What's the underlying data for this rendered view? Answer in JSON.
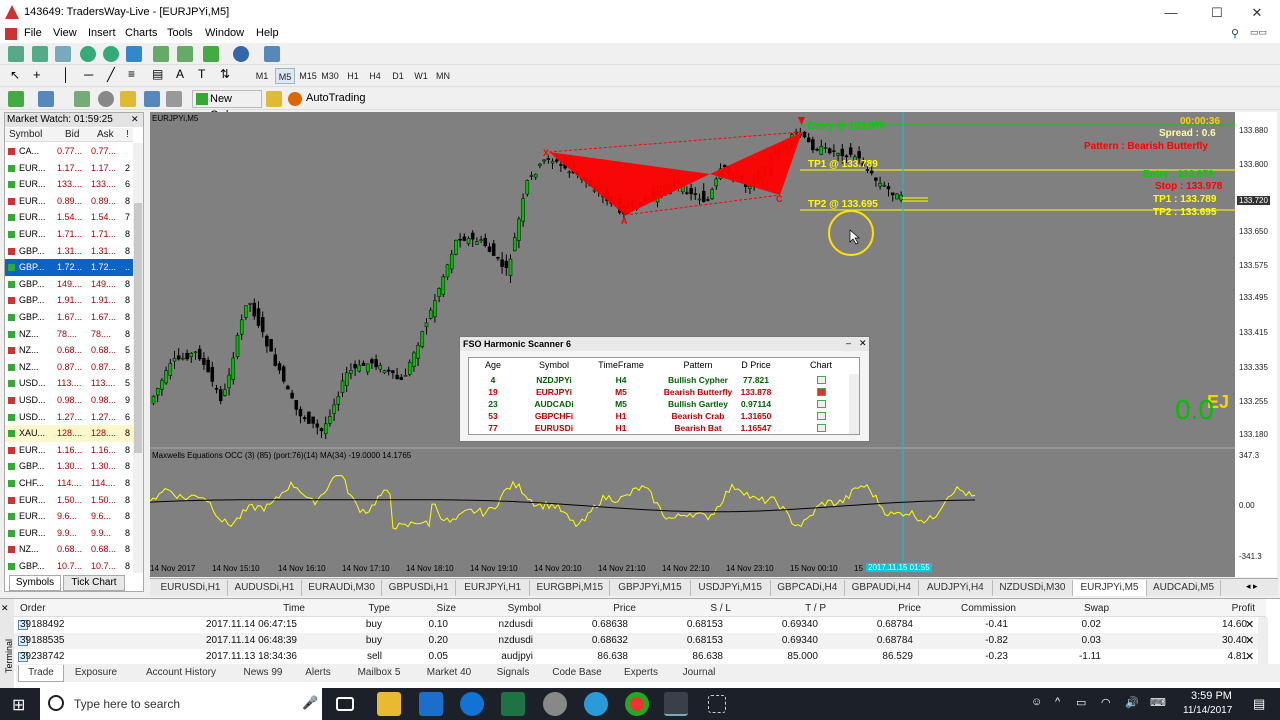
{
  "window": {
    "title": "143649: TradersWay-Live - [EURJPYi,M5]",
    "controls": {
      "minimize": "—",
      "maximize": "☐",
      "close": "✕"
    }
  },
  "menu": [
    "File",
    "View",
    "Insert",
    "Charts",
    "Tools",
    "Window",
    "Help"
  ],
  "timeframes": [
    "M1",
    "M5",
    "M15",
    "M30",
    "H1",
    "H4",
    "D1",
    "W1",
    "MN"
  ],
  "toolbar": {
    "new_order": "New Order",
    "autotrading": "AutoTrading"
  },
  "market_watch": {
    "title": "Market Watch: 01:59:25",
    "cols": [
      "Symbol",
      "Bid",
      "Ask",
      "!"
    ],
    "rows": [
      [
        "CA...",
        "0.77...",
        "0.77...",
        ""
      ],
      [
        "EUR...",
        "1.17...",
        "1.17...",
        "2"
      ],
      [
        "EUR...",
        "133....",
        "133....",
        "6"
      ],
      [
        "EUR...",
        "0.89...",
        "0.89...",
        "8"
      ],
      [
        "EUR...",
        "1.54...",
        "1.54...",
        "7"
      ],
      [
        "EUR...",
        "1.71...",
        "1.71...",
        "8"
      ],
      [
        "GBP...",
        "1.31...",
        "1.31...",
        "8"
      ],
      [
        "GBP...",
        "1.72...",
        "1.72...",
        ".."
      ],
      [
        "GBP...",
        "149....",
        "149....",
        "8"
      ],
      [
        "GBP...",
        "1.91...",
        "1.91...",
        "8"
      ],
      [
        "GBP...",
        "1.67...",
        "1.67...",
        "8"
      ],
      [
        "NZ...",
        "78....",
        "78....",
        "8"
      ],
      [
        "NZ...",
        "0.68...",
        "0.68...",
        "5"
      ],
      [
        "NZ...",
        "0.87...",
        "0.87...",
        "8"
      ],
      [
        "USD...",
        "113....",
        "113....",
        "5"
      ],
      [
        "USD...",
        "0.98...",
        "0.98...",
        "9"
      ],
      [
        "USD...",
        "1.27...",
        "1.27...",
        "6"
      ],
      [
        "XAU...",
        "128....",
        "128....",
        "8"
      ],
      [
        "EUR...",
        "1.16...",
        "1.16...",
        "8"
      ],
      [
        "GBP...",
        "1.30...",
        "1.30...",
        "8"
      ],
      [
        "CHF...",
        "114....",
        "114....",
        "8"
      ],
      [
        "EUR...",
        "1.50...",
        "1.50...",
        "8"
      ],
      [
        "EUR...",
        "9.6...",
        "9.6...",
        "8"
      ],
      [
        "EUR...",
        "9.9...",
        "9.9...",
        "8"
      ],
      [
        "NZ...",
        "0.68...",
        "0.68...",
        "8"
      ],
      [
        "GBP...",
        "10.7...",
        "10.7...",
        "8"
      ]
    ],
    "tabs": [
      "Symbols",
      "Tick Chart"
    ]
  },
  "chart": {
    "label": "EURJPYi,M5",
    "timer": "00:00:36",
    "spread": "Spread : 0.6",
    "pattern": "Pattern : Bearish Butterfly",
    "entry_line": "Entry @ 133.878",
    "tp1_line": "TP1 @ 133.789",
    "tp2_line": "TP2 @ 133.695",
    "entry": "Entry : 133.878",
    "stop": "Stop : 133.978",
    "tp1": "TP1 : 133.789",
    "tp2": "TP2 : 133.695",
    "points": [
      "X",
      "A",
      "B",
      "C"
    ],
    "symbol_badge": "EJ",
    "big_value": "0.0",
    "prices": [
      "133.880",
      "133.800",
      "133.720",
      "133.650",
      "133.575",
      "133.495",
      "133.415",
      "133.335",
      "133.255",
      "133.180"
    ],
    "current_price": "133.720",
    "indicator": "Maxwells Equations OCC (3) (85) (port:76)(14) MA(34) -19.0000 14.1765",
    "ind_axis": [
      "347.3",
      "0.00",
      "-341.3"
    ],
    "times": [
      "14 Nov 2017",
      "14 Nov 15:10",
      "14 Nov 16:10",
      "14 Nov 17:10",
      "14 Nov 18:10",
      "14 Nov 19:10",
      "14 Nov 20:10",
      "14 Nov 21:10",
      "14 Nov 22:10",
      "14 Nov 23:10",
      "15 Nov 00:10",
      "15"
    ],
    "time_cursor": "2017.11.15 01:55",
    "colors": {
      "bg": "#808080",
      "bull": "#00c000",
      "bear": "#ff0000",
      "pattern": "#ff0000",
      "osc": "#ffff00"
    }
  },
  "scanner": {
    "title": "FSO Harmonic Scanner 6",
    "cols": [
      "Age",
      "Symbol",
      "TimeFrame",
      "Pattern",
      "D Price",
      "Chart"
    ],
    "rows": [
      {
        "age": "4",
        "sym": "NZDJPYi",
        "tf": "H4",
        "pat": "Bullish Cypher",
        "price": "77.821",
        "color": "#006000"
      },
      {
        "age": "19",
        "sym": "EURJPYi",
        "tf": "M5",
        "pat": "Bearish Butterfly",
        "price": "133.878",
        "color": "#c00000"
      },
      {
        "age": "23",
        "sym": "AUDCADi",
        "tf": "M5",
        "pat": "Bullish Gartley",
        "price": "0.97114",
        "color": "#006000"
      },
      {
        "age": "53",
        "sym": "GBPCHFi",
        "tf": "H1",
        "pat": "Bearish Crab",
        "price": "1.31650",
        "color": "#c00000"
      },
      {
        "age": "77",
        "sym": "EURUSDi",
        "tf": "H1",
        "pat": "Bearish Bat",
        "price": "1.16547",
        "color": "#c00000"
      }
    ]
  },
  "chart_tabs": [
    "EURUSDi,H1",
    "AUDUSDi,H1",
    "EURAUDi,M30",
    "GBPUSDi,H1",
    "EURJPYi,H1",
    "EURGBPi,M15",
    "GBPJPYi,M15",
    "USDJPYi,M15",
    "GBPCADi,H4",
    "GBPAUDi,H4",
    "AUDJPYi,H4",
    "NZDUSDi,M30",
    "EURJPYi,M5",
    "AUDCADi,M5"
  ],
  "terminal": {
    "side_label": "Terminal",
    "cols": [
      "Order",
      "Time",
      "Type",
      "Size",
      "Symbol",
      "Price",
      "S / L",
      "T / P",
      "Price",
      "Commission",
      "Swap",
      "Profit"
    ],
    "rows": [
      [
        "39188492",
        "2017.11.14 06:47:15",
        "buy",
        "0.10",
        "nzdusdi",
        "0.68638",
        "0.68153",
        "0.69340",
        "0.68784",
        "-0.41",
        "0.02",
        "14.60"
      ],
      [
        "39188535",
        "2017.11.14 06:48:39",
        "buy",
        "0.20",
        "nzdusdi",
        "0.68632",
        "0.68153",
        "0.69340",
        "0.68784",
        "-0.82",
        "0.03",
        "30.40"
      ],
      [
        "39238742",
        "2017.11.13 18:34:36",
        "sell",
        "0.05",
        "audjpyi",
        "86.638",
        "86.638",
        "85.000",
        "86.529",
        "-0.23",
        "-1.11",
        "4.81"
      ]
    ],
    "tabs": [
      "Trade",
      "Exposure",
      "Account History",
      "News 99",
      "Alerts",
      "Mailbox 5",
      "Market 40",
      "Signals",
      "Code Base",
      "Experts",
      "Journal"
    ]
  },
  "taskbar": {
    "search": "Type here to search",
    "time": "3:59 PM",
    "date": "11/14/2017"
  }
}
